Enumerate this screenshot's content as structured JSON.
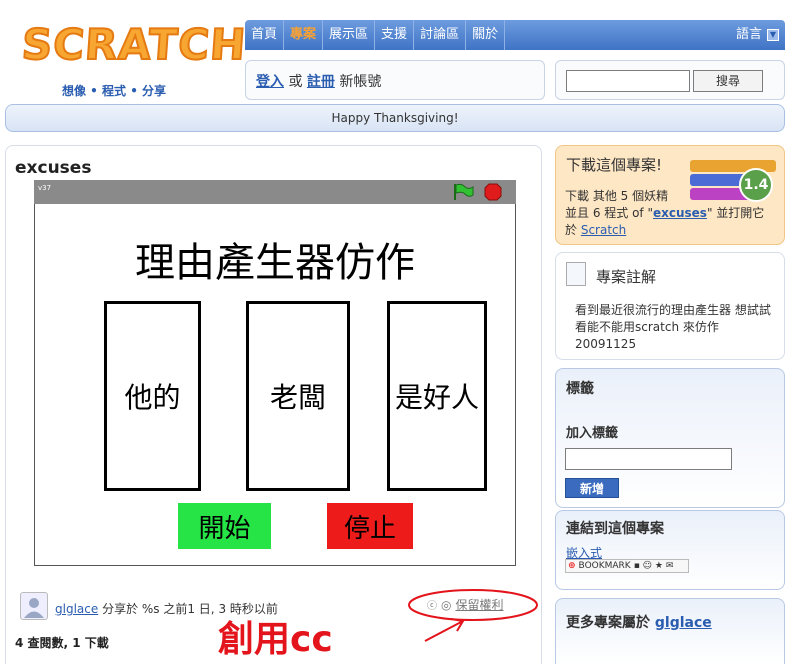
{
  "logo": {
    "text": "SCRATCH",
    "tagline": "想像 • 程式 • 分享"
  },
  "nav": {
    "items": [
      "首頁",
      "專案",
      "展示區",
      "支援",
      "討論區",
      "關於"
    ],
    "active_index": 1,
    "language": "語言"
  },
  "login": {
    "login_label": "登入",
    "or": "或",
    "register_label": "註冊",
    "new_account": "新帳號"
  },
  "search": {
    "placeholder": "",
    "button": "搜尋"
  },
  "banner": {
    "text": "Happy Thanksgiving!"
  },
  "project": {
    "title": "excuses",
    "version": "v37",
    "stage_title": "理由產生器仿作",
    "cards": [
      "他的",
      "老闆",
      "是好人"
    ],
    "start_button": "開始",
    "stop_button": "停止",
    "author": "glglace",
    "shared_text": "分享於 %s 之前1 日, 3 時秒以前",
    "stats": "4 查閱數, 1 下載",
    "rights": "保留權利",
    "annotation": "創用cc"
  },
  "download": {
    "title": "下載這個專案!",
    "line1": "下載 其他 5 個妖精",
    "line2_pre": "並且 6 程式 of \"",
    "project_link": "excuses",
    "line2_post": "\" 並打開它",
    "line3_pre": "於 ",
    "scratch_link": "Scratch",
    "version_badge": "1.4"
  },
  "notes": {
    "title": "專案註解",
    "text": "看到最近很流行的理由產生器 想試試看能不能用scratch 來仿作 20091125"
  },
  "tags": {
    "title": "標籤",
    "add_label": "加入標籤",
    "button": "新增"
  },
  "links": {
    "title": "連結到這個專案",
    "embed": "嵌入式",
    "bookmark": "BOOKMARK"
  },
  "more": {
    "title_prefix": "更多專案屬於",
    "user": "glglace"
  },
  "colors": {
    "accent": "#2a5db0",
    "start_green": "#26e346",
    "stop_red": "#ee1b1b",
    "annotation_red": "#e3141b"
  }
}
